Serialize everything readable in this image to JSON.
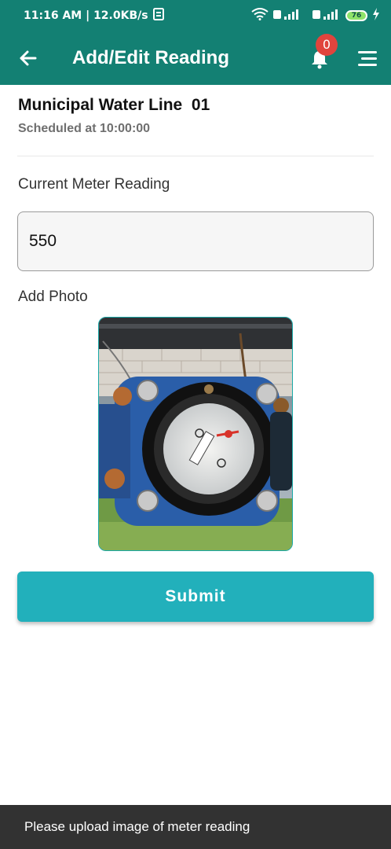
{
  "status_bar": {
    "time_speed": "11:16 AM | 12.0KB/s",
    "battery": "76"
  },
  "app_bar": {
    "title": "Add/Edit Reading",
    "notification_count": "0"
  },
  "header": {
    "line_name": "Municipal Water Line  01",
    "scheduled": "Scheduled at 10:00:00"
  },
  "form": {
    "reading_label": "Current Meter Reading",
    "reading_value": "550",
    "photo_label": "Add Photo",
    "submit_label": "Submit"
  },
  "toast": {
    "message": "Please upload image of meter reading"
  },
  "colors": {
    "primary": "#138073",
    "button": "#22b0bb",
    "badge": "#e0443d",
    "toast_bg": "#323232"
  },
  "icons": [
    "back-arrow-icon",
    "bell-icon",
    "menu-icon",
    "wifi-icon",
    "signal-icon",
    "battery-icon",
    "charging-icon",
    "sim-icon"
  ]
}
